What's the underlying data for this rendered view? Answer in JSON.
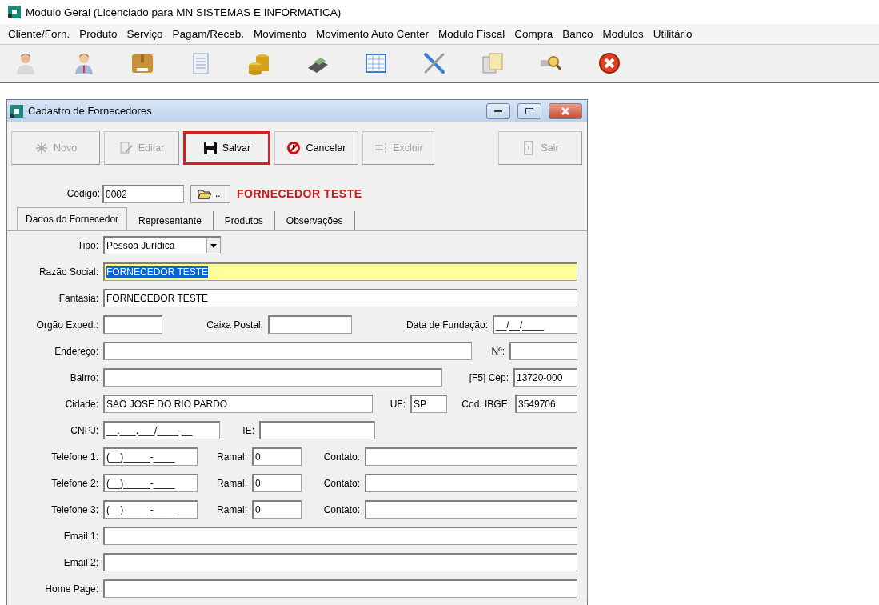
{
  "window": {
    "title": "Modulo Geral (Licenciado para MN SISTEMAS E INFORMATICA)"
  },
  "menu": [
    {
      "label": "Cliente/Forn."
    },
    {
      "label": "Produto"
    },
    {
      "label": "Serviço"
    },
    {
      "label": "Pagam/Receb."
    },
    {
      "label": "Movimento"
    },
    {
      "label": "Movimento Auto Center"
    },
    {
      "label": "Modulo Fiscal"
    },
    {
      "label": "Compra"
    },
    {
      "label": "Banco"
    },
    {
      "label": "Modulos"
    },
    {
      "label": "Utilitário"
    }
  ],
  "toolbar": [
    {
      "kind": "person"
    },
    {
      "kind": "businessman"
    },
    {
      "kind": "box"
    },
    {
      "kind": "document"
    },
    {
      "kind": "coins"
    },
    {
      "kind": "terminal"
    },
    {
      "kind": "grid"
    },
    {
      "kind": "tools"
    },
    {
      "kind": "papers"
    },
    {
      "kind": "search"
    },
    {
      "kind": "exit"
    }
  ],
  "dialog": {
    "title": "Cadastro de Fornecedores",
    "buttons": [
      {
        "label": "Novo",
        "kind": "new",
        "disabled": true,
        "highlighted": false
      },
      {
        "label": "Editar",
        "kind": "edit",
        "disabled": true,
        "highlighted": false
      },
      {
        "label": "Salvar",
        "kind": "save",
        "disabled": false,
        "highlighted": true
      },
      {
        "label": "Cancelar",
        "kind": "cancel",
        "disabled": false,
        "highlighted": false
      },
      {
        "label": "Excluir",
        "kind": "delete",
        "disabled": true,
        "highlighted": false
      },
      {
        "label": "Sair",
        "kind": "exit",
        "disabled": true,
        "highlighted": false
      }
    ],
    "code": {
      "label": "Código:",
      "value": "0002",
      "button": "...",
      "name": "FORNECEDOR TESTE"
    },
    "tabs": [
      {
        "label": "Dados do Fornecedor",
        "selected": true
      },
      {
        "label": "Representante",
        "selected": false
      },
      {
        "label": "Produtos",
        "selected": false
      },
      {
        "label": "Observações",
        "selected": false
      }
    ],
    "rows": [
      [
        {
          "label": "Tipo:",
          "kind": "dropdown",
          "value": "Pessoa Jurídica",
          "focused": false
        }
      ],
      [
        {
          "label": "Razão Social:",
          "kind": "text",
          "value": "FORNECEDOR TESTE",
          "focused": true
        }
      ],
      [
        {
          "label": "Fantasia:",
          "kind": "text",
          "value": "FORNECEDOR TESTE",
          "focused": false
        }
      ],
      [
        {
          "label": "Orgão Exped.:",
          "kind": "text",
          "focused": false
        },
        {
          "label": "Caixa Postal:",
          "kind": "text",
          "focused": false
        },
        {
          "label": "Data de Fundação:",
          "kind": "text",
          "value": "__/__/____",
          "focused": false
        }
      ],
      [
        {
          "label": "Endereço:",
          "kind": "text",
          "focused": false
        },
        {
          "label": "Nº:",
          "kind": "text",
          "focused": false
        }
      ],
      [
        {
          "label": "Bairro:",
          "kind": "text",
          "focused": false
        },
        {
          "label": "[F5] Cep:",
          "kind": "text",
          "value": "13720-000",
          "focused": false
        }
      ],
      [
        {
          "label": "Cidade:",
          "kind": "text",
          "value": "SAO JOSE DO RIO PARDO",
          "focused": false
        },
        {
          "label": "UF:",
          "kind": "text",
          "value": "SP",
          "focused": false
        },
        {
          "label": "Cod. IBGE:",
          "kind": "text",
          "value": "3549706",
          "focused": false
        }
      ],
      [
        {
          "label": "CNPJ:",
          "kind": "text",
          "value": "__.___.___/____-__",
          "focused": false
        },
        {
          "label": "IE:",
          "kind": "text",
          "focused": false
        }
      ],
      [
        {
          "label": "Telefone 1:",
          "kind": "text",
          "value": "(__)_____-____",
          "focused": false
        },
        {
          "label": "Ramal:",
          "kind": "text",
          "value": "0",
          "focused": false
        },
        {
          "label": "Contato:",
          "kind": "text",
          "focused": false
        }
      ],
      [
        {
          "label": "Telefone 2:",
          "kind": "text",
          "value": "(__)_____-____",
          "focused": false
        },
        {
          "label": "Ramal:",
          "kind": "text",
          "value": "0",
          "focused": false
        },
        {
          "label": "Contato:",
          "kind": "text",
          "focused": false
        }
      ],
      [
        {
          "label": "Telefone 3:",
          "kind": "text",
          "value": "(__)_____-____",
          "focused": false
        },
        {
          "label": "Ramal:",
          "kind": "text",
          "value": "0",
          "focused": false
        },
        {
          "label": "Contato:",
          "kind": "text",
          "focused": false
        }
      ],
      [
        {
          "label": "Email 1:",
          "kind": "text",
          "focused": false
        }
      ],
      [
        {
          "label": "Email 2:",
          "kind": "text",
          "focused": false
        }
      ],
      [
        {
          "label": "Home Page:",
          "kind": "text",
          "focused": false
        }
      ]
    ]
  }
}
